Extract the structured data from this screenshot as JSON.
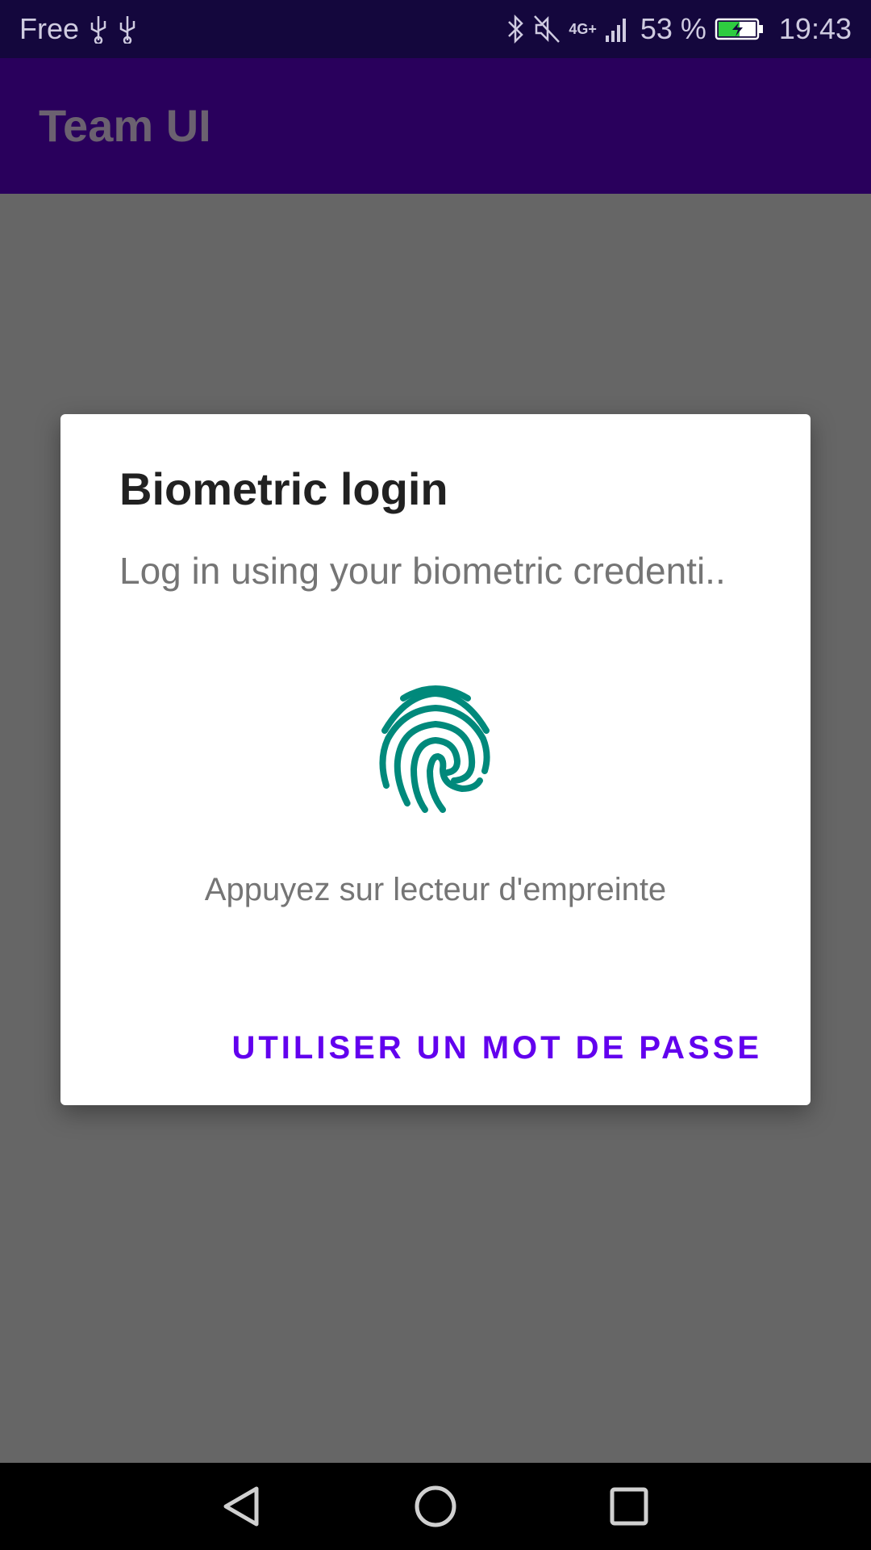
{
  "status_bar": {
    "carrier": "Free",
    "network": "4G+",
    "battery": "53 %",
    "time": "19:43",
    "icons": [
      "usb-icon",
      "usb-icon",
      "bluetooth-icon",
      "mute-icon",
      "signal-icon",
      "battery-charging-icon"
    ]
  },
  "app_bar": {
    "title": "Team UI"
  },
  "dialog": {
    "title": "Biometric login",
    "subtitle": "Log in using your biometric credenti..",
    "icon": "fingerprint-icon",
    "hint": "Appuyez sur lecteur d'empreinte",
    "button_label": "UTILISER UN MOT DE PASSE"
  },
  "nav_bar": {
    "icons": [
      "back-icon",
      "home-icon",
      "recents-icon"
    ]
  },
  "colors": {
    "status_bar": "#14073d",
    "app_bar": "#29005c",
    "scrim": "#666666",
    "accent": "#6200ee",
    "fingerprint": "#00897b"
  }
}
